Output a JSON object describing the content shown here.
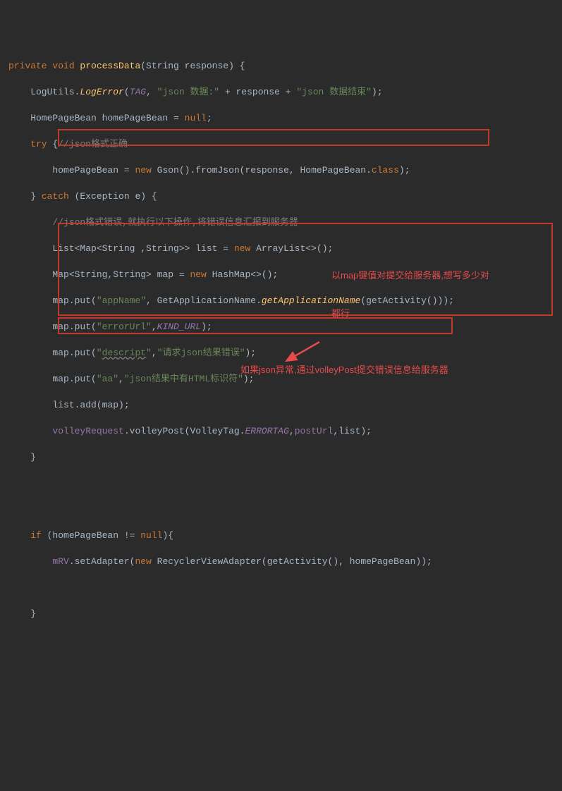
{
  "code": {
    "l1_kw1": "private void",
    "l1_method": " processData",
    "l1_rest": "(String response) {",
    "l2_a": "    LogUtils.",
    "l2_m": "LogError",
    "l2_b": "(",
    "l2_tag": "TAG",
    "l2_c": ", ",
    "l2_s1": "\"json 数据:\"",
    "l2_d": " + response + ",
    "l2_s2": "\"json 数据结束\"",
    "l2_e": ");",
    "l3": "    HomePageBean homePageBean = ",
    "l3_kw": "null",
    "l3_e": ";",
    "l4_kw": "    try ",
    "l4_b": "{",
    "l4_c": "//json格式正确",
    "l5_a": "        homePageBean = ",
    "l5_kw": "new ",
    "l5_b": "Gson().fromJson(response, HomePageBean.",
    "l5_cls": "class",
    "l5_e": ");",
    "l6_a": "    } ",
    "l6_kw": "catch ",
    "l6_b": "(Exception e) {",
    "l7_c": "        //json格式错误,就执行以下操作,将错误信息汇报到服务器",
    "l8_a": "        List<Map<String ,String>> list = ",
    "l8_kw": "new ",
    "l8_b": "ArrayList<>();",
    "l9_a": "        Map<String,String> map = ",
    "l9_kw": "new ",
    "l9_b": "HashMap<>();",
    "l10_a": "        map.put(",
    "l10_s": "\"appName\"",
    "l10_b": ", GetApplicationName.",
    "l10_m": "getApplicationName",
    "l10_c": "(getActivity()));",
    "l11_a": "        map.put(",
    "l11_s": "\"errorUrl\"",
    "l11_b": ",",
    "l11_c": "KIND_URL",
    "l11_d": ");",
    "l12_a": "        map.put(",
    "l12_s1": "\"",
    "l12_s2": "descript",
    "l12_s3": "\"",
    "l12_b": ",",
    "l12_s4": "\"请求json结果错误\"",
    "l12_c": ");",
    "l13_a": "        map.put(",
    "l13_s1": "\"aa\"",
    "l13_b": ",",
    "l13_s2": "\"json结果中有HTML标识符\"",
    "l13_c": ");",
    "l14": "        list.add(map);",
    "l15_a": "        ",
    "l15_f": "volleyRequest",
    "l15_b": ".volleyPost(VolleyTag.",
    "l15_c": "ERRORTAG",
    "l15_d": ",",
    "l15_e": "postUrl",
    "l15_g": ",list);",
    "l16": "    }",
    "l17": "",
    "l18": "",
    "l19_kw": "    if ",
    "l19_a": "(homePageBean != ",
    "l19_n": "null",
    "l19_b": "){",
    "l20_a": "        ",
    "l20_f": "mRV",
    "l20_b": ".setAdapter(",
    "l20_kw": "new ",
    "l20_c": "RecyclerViewAdapter(getActivity(), homePageBean));",
    "l21": "",
    "l22": "    }"
  },
  "annotations": {
    "a1_line1": "以map键值对提交给服务器,想写多少对",
    "a1_line2": "都行",
    "a2": "如果json异常,通过volleyPost提交错误信息给服务器"
  }
}
